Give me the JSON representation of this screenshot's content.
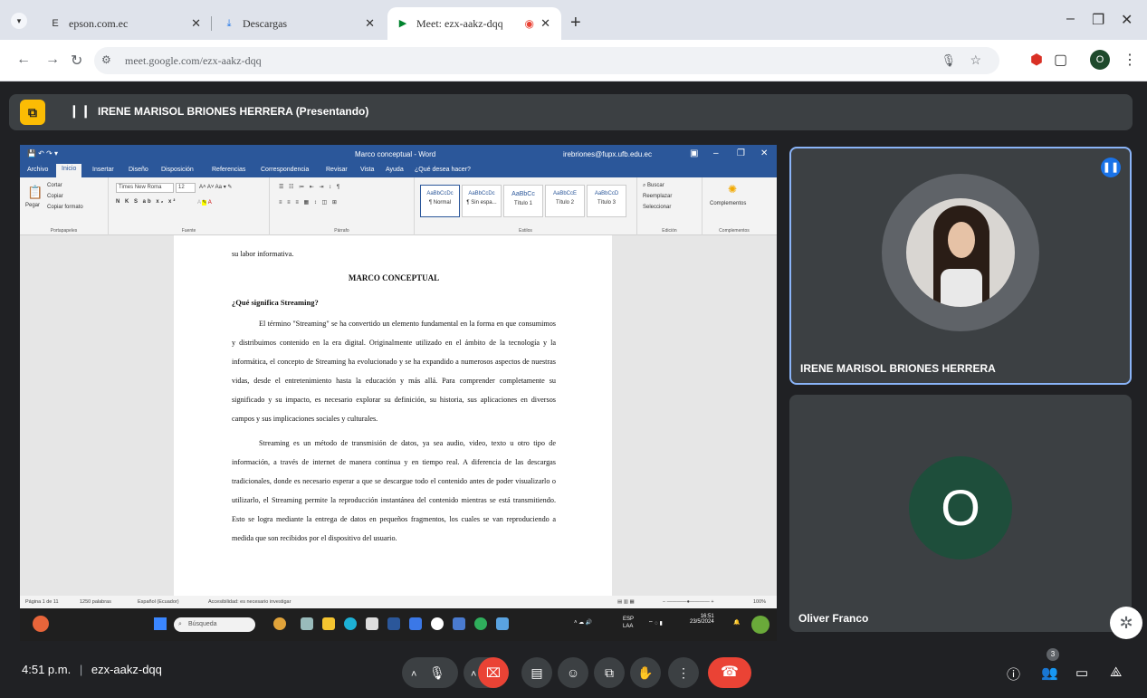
{
  "browser": {
    "tabs": [
      {
        "title": "epson.com.ec",
        "icon": "E"
      },
      {
        "title": "Descargas",
        "icon": "download-icon"
      },
      {
        "title": "Meet: ezx-aakz-dqq",
        "icon": "meet-icon"
      }
    ],
    "url": "meet.google.com/ezx-aakz-dqq",
    "profile_initial": "O"
  },
  "presenter_bar": {
    "label": "IRENE MARISOL BRIONES HERRERA (Presentando)"
  },
  "word": {
    "doc_title": "Marco conceptual - Word",
    "user": "irebriones@fupx.ufb.edu.ec",
    "menu": [
      "Archivo",
      "Inicio",
      "Insertar",
      "Diseño",
      "Disposición",
      "Referencias",
      "Correspondencia",
      "Revisar",
      "Vista",
      "Ayuda",
      "¿Qué desea hacer?"
    ],
    "clipboard": {
      "paste": "Pegar",
      "cut": "Cortar",
      "copy": "Copiar",
      "format": "Copiar formato",
      "label": "Portapapeles"
    },
    "font": {
      "name": "Times New Roma",
      "size": "12",
      "label": "Fuente"
    },
    "paragraph_label": "Párrafo",
    "styles": [
      {
        "sample": "AaBbCcDc",
        "name": "¶ Normal"
      },
      {
        "sample": "AaBbCcDc",
        "name": "¶ Sin espa..."
      },
      {
        "sample": "AaBbCc",
        "name": "Título 1"
      },
      {
        "sample": "AaBbCcE",
        "name": "Título 2"
      },
      {
        "sample": "AaBbCcD",
        "name": "Título 3"
      }
    ],
    "styles_label": "Estilos",
    "edit": {
      "find": "Buscar",
      "replace": "Reemplazar",
      "select": "Seleccionar",
      "label": "Edición"
    },
    "addins": {
      "button": "Complementos",
      "label": "Complementos"
    },
    "doc": {
      "intro": "su labor informativa.",
      "heading": "MARCO CONCEPTUAL",
      "subheading": "¿Qué significa Streaming?",
      "p1": "El término \"Streaming\" se ha convertido un elemento fundamental en la forma en que consumimos y distribuimos contenido en la era digital. Originalmente utilizado en el ámbito de la tecnología y la informática, el concepto de Streaming ha evolucionado y se ha expandido a numerosos aspectos de nuestras vidas, desde el entretenimiento hasta la educación y más allá. Para comprender completamente su significado y su impacto, es necesario explorar su definición, su historia, sus aplicaciones en diversos campos y sus implicaciones sociales y culturales.",
      "p2": "Streaming es un método de transmisión de datos, ya sea audio, video, texto u otro tipo de información, a través de internet de manera continua y en tiempo real. A diferencia de las descargas tradicionales, donde es necesario esperar a que se descargue todo el contenido antes de poder visualizarlo o utilizarlo, el Streaming permite la reproducción instantánea del contenido mientras se está transmitiendo. Esto se logra mediante la entrega de datos en pequeños fragmentos, los cuales se van reproduciendo a medida que son recibidos por el dispositivo del usuario."
    },
    "status": {
      "page": "Página 1 de 11",
      "words": "1250 palabras",
      "lang": "Español (Ecuador)",
      "accessibility": "Accesibilidad: es necesario investigar",
      "zoom": "100%"
    },
    "taskbar": {
      "search": "Búsqueda",
      "lang": "ESP LAA",
      "time": "16:51",
      "date": "23/5/2024"
    }
  },
  "participants": [
    {
      "name": "IRENE MARISOL BRIONES HERRERA",
      "speaking": true
    },
    {
      "name": "Oliver Franco",
      "initial": "O"
    }
  ],
  "bottom": {
    "time": "4:51 p.m.",
    "separator": "|",
    "code": "ezx-aakz-dqq",
    "people_count": "3"
  },
  "colors": {
    "meet_bg": "#202124",
    "tile_bg": "#3c4043",
    "active_border": "#8ab4f8",
    "end_call": "#ea4335",
    "word_blue": "#2b579a"
  }
}
